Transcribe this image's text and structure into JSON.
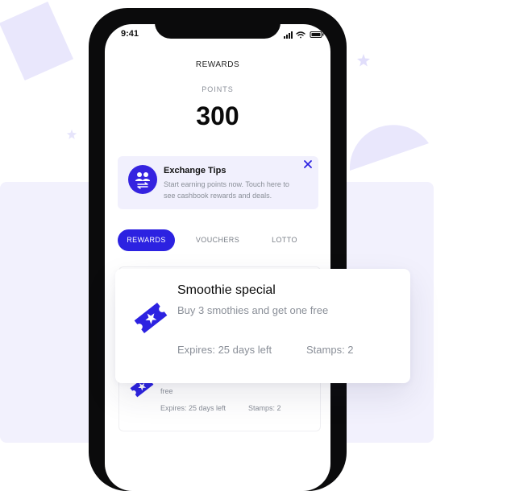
{
  "colors": {
    "accent": "#2c22e1",
    "decor": "#e9e7fc",
    "panel": "#f2f1fd",
    "muted_text": "#8a8f98"
  },
  "status_bar": {
    "time": "9:41",
    "icons": [
      "signal-icon",
      "wifi-icon",
      "battery-icon"
    ]
  },
  "screen": {
    "title": "REWARDS",
    "points_label": "POINTS",
    "points_value": "300"
  },
  "tips": {
    "title": "Exchange Tips",
    "body": "Start earning points now. Touch here to see cashbook rewards and deals.",
    "icons": [
      "users-exchange-icon",
      "close-icon"
    ]
  },
  "tabs": [
    {
      "label": "REWARDS",
      "active": true
    },
    {
      "label": "VOUCHERS",
      "active": false
    },
    {
      "label": "LOTTO",
      "active": false
    }
  ],
  "featured_card": {
    "title": "Smoothie special",
    "description": "Buy 3 smothies and get one free",
    "expires": "Expires: 25 days left",
    "stamps": "Stamps: 2",
    "icon": "ticket-star-icon"
  },
  "background_card": {
    "description_tail": "free",
    "expires": "Expires: 25 days left",
    "stamps": "Stamps: 2",
    "icon": "ticket-star-icon"
  }
}
